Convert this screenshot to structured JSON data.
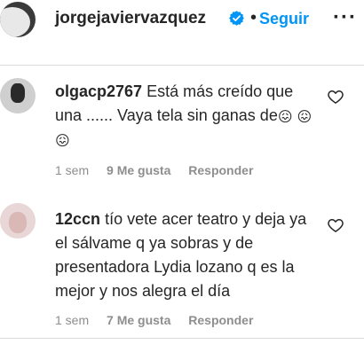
{
  "post_header": {
    "username": "jorgejaviervazquez",
    "follow_label": "Seguir",
    "separator": "•",
    "more_label": "···"
  },
  "comments": [
    {
      "username": "olgacp2767",
      "text": "Está más creído que una ...... Vaya tela sin ganas de",
      "emojis": [
        "😖",
        "😖",
        "😖"
      ],
      "time": "1 sem",
      "likes": "9 Me gusta",
      "reply_label": "Responder"
    },
    {
      "username": "12ccn",
      "text": "tío vete acer teatro y deja ya el sálvame q ya sobras y de presentadora Lydia lozano q es la mejor y nos alegra el día",
      "time": "1 sem",
      "likes": "7 Me gusta",
      "reply_label": "Responder"
    }
  ],
  "colors": {
    "accent": "#0095f6",
    "text": "#262626",
    "muted": "#8e8e8e",
    "divider": "#dbdbdb"
  }
}
